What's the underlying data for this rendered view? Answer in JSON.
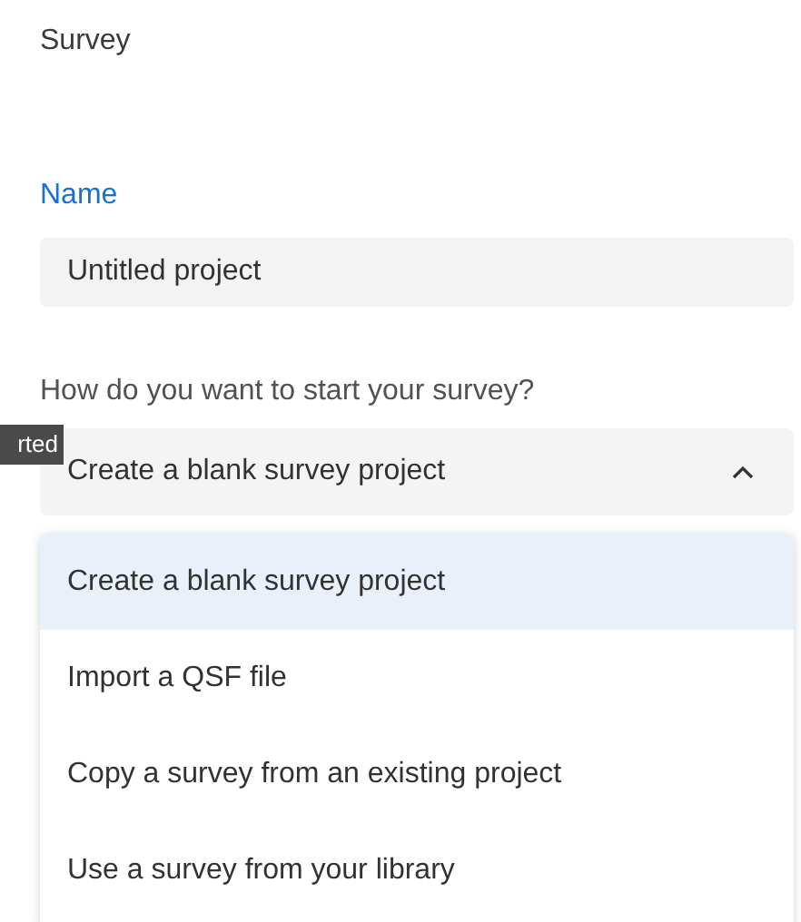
{
  "header": {
    "title": "Survey"
  },
  "name_field": {
    "label": "Name",
    "value": "Untitled project"
  },
  "start_select": {
    "label": "How do you want to start your survey?",
    "value": "Create a blank survey project",
    "expanded": true
  },
  "tooltip": {
    "text": "rted"
  },
  "options": [
    {
      "label": "Create a blank survey project",
      "selected": true
    },
    {
      "label": "Import a QSF file",
      "selected": false
    },
    {
      "label": "Copy a survey from an existing project",
      "selected": false
    },
    {
      "label": "Use a survey from your library",
      "selected": false
    }
  ]
}
